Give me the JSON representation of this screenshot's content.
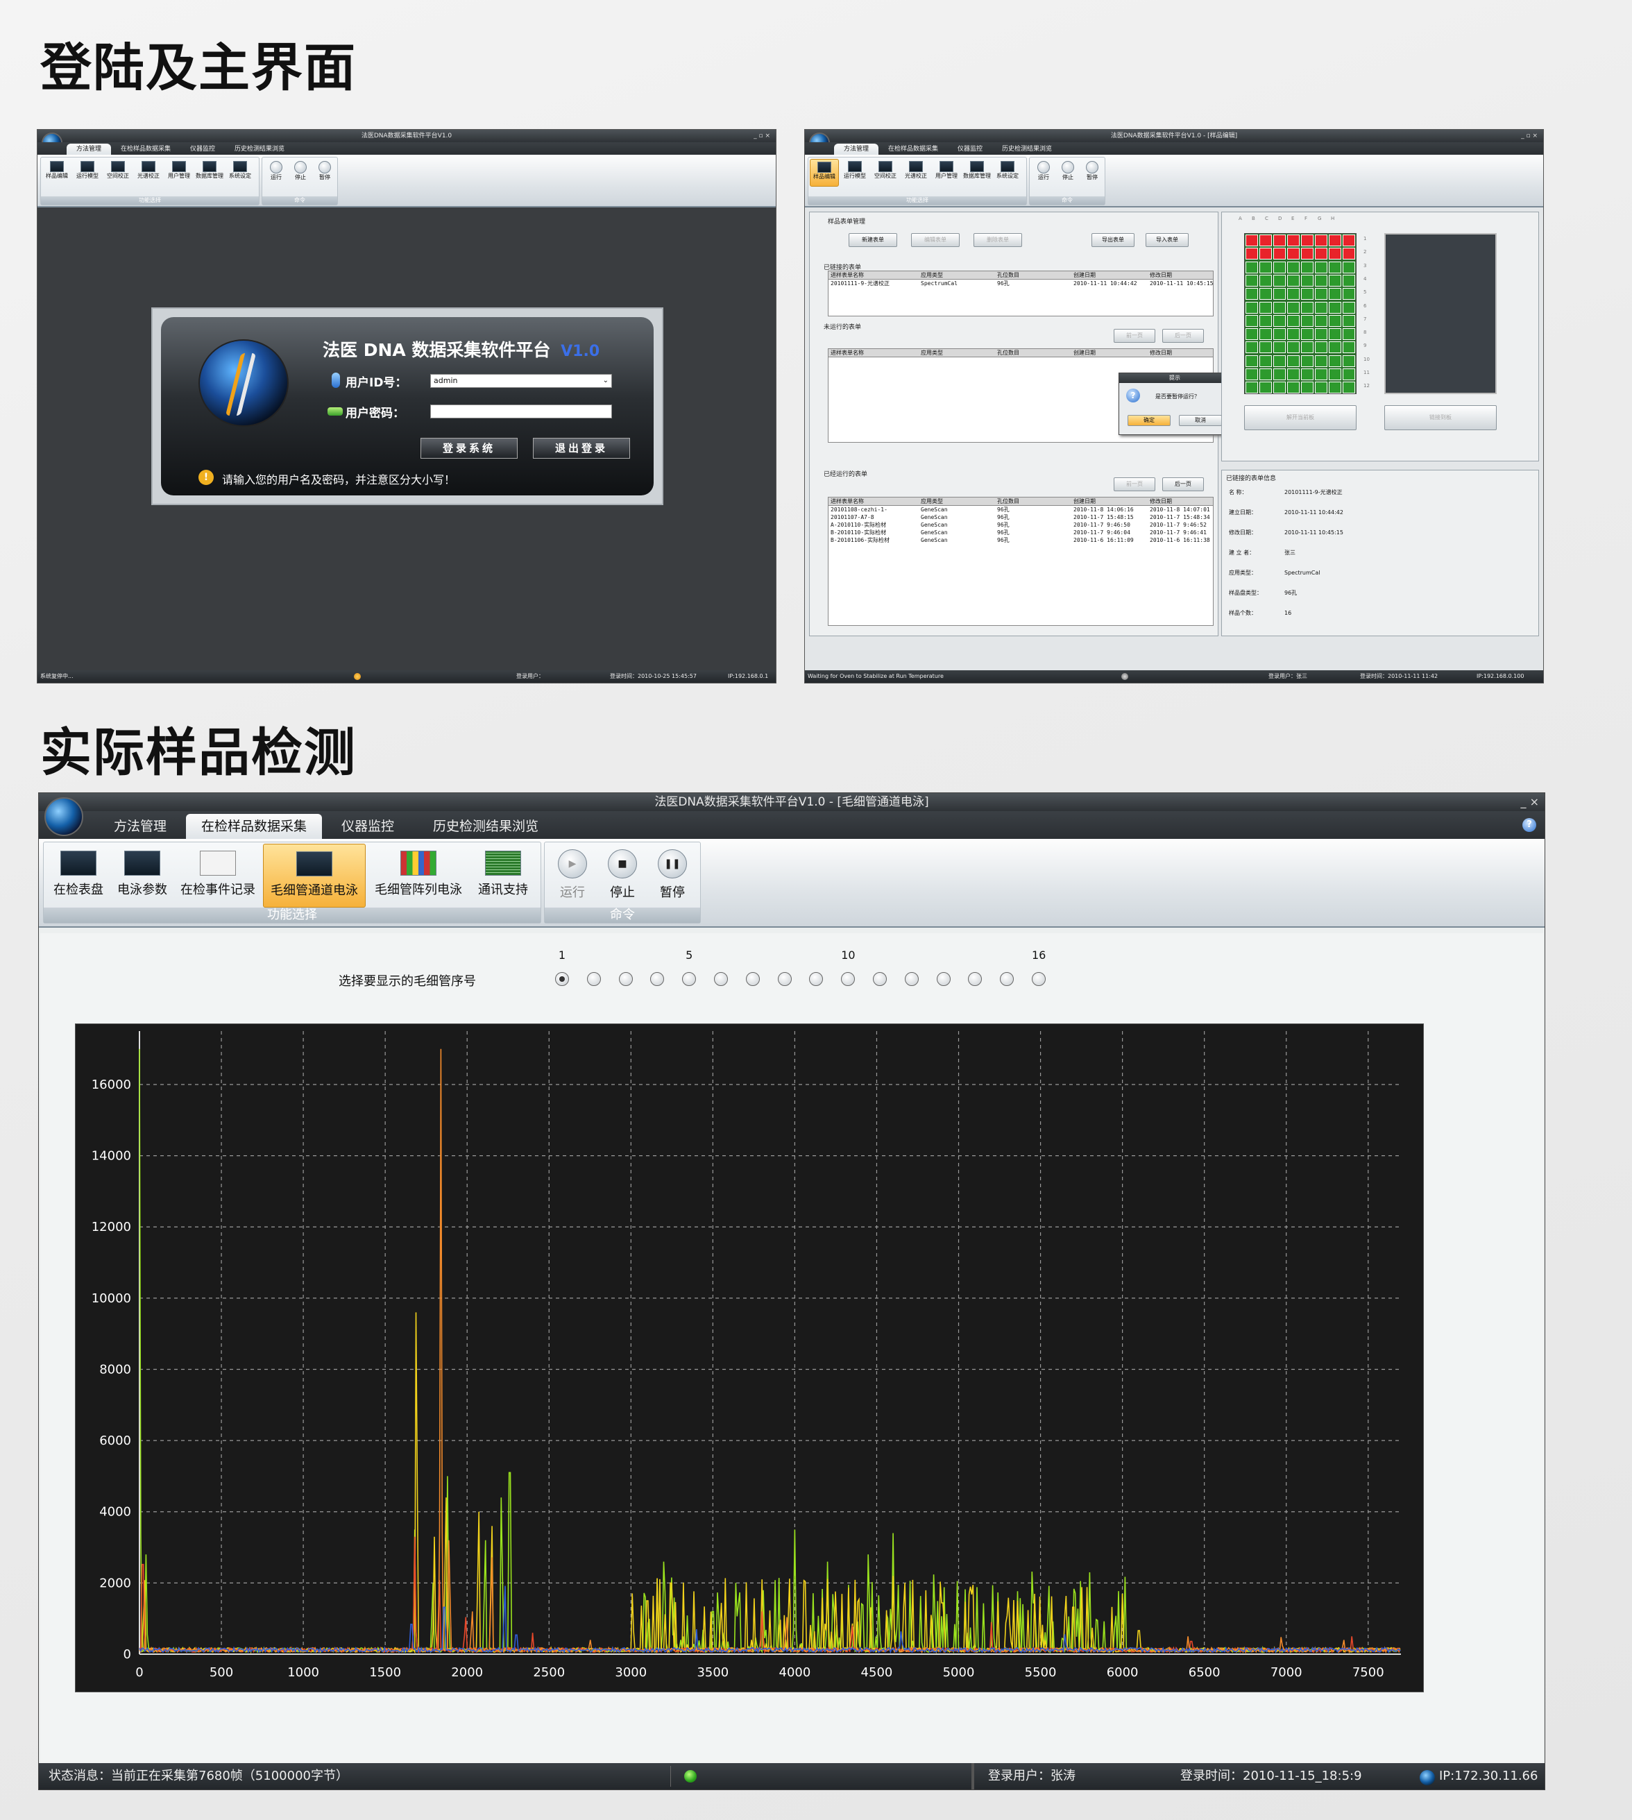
{
  "headings": {
    "login": "登陆及主界面",
    "detection": "实际样品检测"
  },
  "login_window": {
    "title": "法医DNA数据采集软件平台V1.0",
    "tabs": [
      "方法管理",
      "在检样品数据采集",
      "仪器监控",
      "历史检测结果浏览"
    ],
    "ribbon_buttons": [
      "样品编辑",
      "运行模型",
      "空间校正",
      "光谱校正",
      "用户管理",
      "数据库管理",
      "系统设定"
    ],
    "group_caption": "功能选择",
    "cmd_buttons": [
      "运行",
      "停止",
      "暂停"
    ],
    "cmd_caption": "命令",
    "dialog": {
      "title_prefix": "法医 DNA 数据采集软件平台",
      "version": "V1.0",
      "user_id_label": "用户ID号：",
      "user_id_value": "admin",
      "password_label": "用户密码：",
      "login_button": "登录系统",
      "exit_button": "退出登录",
      "hint": "请输入您的用户名及密码，并注意区分大小写！"
    },
    "status": {
      "msg": "系统复停中...",
      "user": "登录用户：",
      "time": "登录时间：2010-10-25 15:45:57",
      "ip": "IP:192.168.0.1"
    }
  },
  "main_window": {
    "title": "法医DNA数据采集软件平台V1.0 - [样品编辑]",
    "tabs": [
      "方法管理",
      "在检样品数据采集",
      "仪器监控",
      "历史检测结果浏览"
    ],
    "ribbon_buttons": [
      "样品编辑",
      "运行模型",
      "空间校正",
      "光谱校正",
      "用户管理",
      "数据库管理",
      "系统设定"
    ],
    "group_caption": "功能选择",
    "cmd_buttons": [
      "运行",
      "停止",
      "暂停"
    ],
    "cmd_caption": "命令",
    "sample_table_panel": "样品表单管理",
    "buttons_top": [
      "新建表单",
      "编辑表单",
      "删除表单",
      "导出表单",
      "导入表单"
    ],
    "linked_label": "已链接的表单",
    "table_headers": [
      "进样表单名称",
      "应用类型",
      "孔位数目",
      "创建日期",
      "修改日期"
    ],
    "linked_rows": [
      [
        "20101111-9-光谱校正",
        "SpectrumCal",
        "96孔",
        "2010-11-11 10:44:42",
        "2010-11-11 10:45:15"
      ]
    ],
    "not_run_label": "未运行的表单",
    "page_buttons": [
      "前一页",
      "后一页"
    ],
    "run_label": "已经运行的表单",
    "run_rows": [
      [
        "20101108-cezhi-1-",
        "GeneScan",
        "96孔",
        "2010-11-8 14:06:16",
        "2010-11-8 14:07:01"
      ],
      [
        "20101107-A7-8",
        "GeneScan",
        "96孔",
        "2010-11-7 15:48:15",
        "2010-11-7 15:48:34"
      ],
      [
        "A-2010110-实际检材",
        "GeneScan",
        "96孔",
        "2010-11-7 9:46:50",
        "2010-11-7 9:46:52"
      ],
      [
        "B-2010110-实际检材",
        "GeneScan",
        "96孔",
        "2010-11-7 9:46:04",
        "2010-11-7 9:46:41"
      ],
      [
        "B-20101106-实际检材",
        "GeneScan",
        "96孔",
        "2010-11-6 16:11:09",
        "2010-11-6 16:11:38"
      ]
    ],
    "dialog": {
      "title": "提示",
      "text": "是否要暂停运行？",
      "ok": "确定",
      "cancel": "取消"
    },
    "plate_columns": [
      "A",
      "B",
      "C",
      "D",
      "E",
      "F",
      "G",
      "H"
    ],
    "plate_buttons": [
      "解开当前板",
      "链接到板"
    ],
    "info_label": "已链接的表单信息",
    "info": [
      [
        "名    称：",
        "20101111-9-光谱校正"
      ],
      [
        "建立日期：",
        "2010-11-11 10:44:42"
      ],
      [
        "修改日期：",
        "2010-11-11 10:45:15"
      ],
      [
        "建 立 者：",
        "张三"
      ],
      [
        "应用类型：",
        "SpectrumCal"
      ],
      [
        "样品盘类型：",
        "96孔"
      ],
      [
        "样品个数：",
        "16"
      ]
    ],
    "status": {
      "msg": "Waiting for Oven to Stabilize at Run Temperature",
      "user": "登录用户：张三",
      "time": "登录时间：2010-11-11 11:42",
      "ip": "IP:192.168.0.100"
    }
  },
  "big_window": {
    "title": "法医DNA数据采集软件平台V1.0 - [毛细管通道电泳]",
    "tabs": [
      "方法管理",
      "在检样品数据采集",
      "仪器监控",
      "历史检测结果浏览"
    ],
    "ribbon_buttons": [
      "在检表盘",
      "电泳参数",
      "在检事件记录",
      "毛细管通道电泳",
      "毛细管阵列电泳",
      "通讯支持"
    ],
    "ribbon_icons": [
      "plate-icon",
      "chart-icon",
      "log-icon",
      "electropherogram-icon",
      "array-icon",
      "comm-icon"
    ],
    "group_caption": "功能选择",
    "cmd_buttons": [
      "运行",
      "停止",
      "暂停"
    ],
    "cmd_caption": "命令",
    "capillary_label": "选择要显示的毛细管序号",
    "capillary_ticks": [
      {
        "n": "1",
        "i": 0
      },
      {
        "n": "5",
        "i": 4
      },
      {
        "n": "10",
        "i": 9
      },
      {
        "n": "16",
        "i": 15
      }
    ],
    "capillary_count": 16,
    "capillary_selected": 1,
    "status": {
      "msg": "状态消息：当前正在采集第7680帧（5100000字节）",
      "user": "登录用户：张涛",
      "time": "登录时间：2010-11-15_18:5:9",
      "ip": "IP:172.30.11.66"
    }
  },
  "chart_data": {
    "type": "line",
    "xlim": [
      0,
      7700
    ],
    "ylim": [
      0,
      17500
    ],
    "x_ticks": [
      0,
      500,
      1000,
      1500,
      2000,
      2500,
      3000,
      3500,
      4000,
      4500,
      5000,
      5500,
      6000,
      6500,
      7000,
      7500
    ],
    "y_ticks": [
      0,
      2000,
      4000,
      6000,
      8000,
      10000,
      12000,
      14000,
      16000
    ],
    "grid": true,
    "background": "#1a1a1a",
    "series": [
      {
        "color": "#9be31e",
        "peaks": [
          [
            0,
            17000
          ],
          [
            40,
            2800
          ],
          [
            1680,
            3500
          ],
          [
            1790,
            2500
          ],
          [
            1880,
            5000
          ],
          [
            2110,
            4000
          ],
          [
            2210,
            5500
          ],
          [
            2260,
            8500
          ],
          [
            3200,
            2600
          ],
          [
            3500,
            2000
          ],
          [
            4000,
            3500
          ],
          [
            4200,
            2600
          ],
          [
            4450,
            3500
          ],
          [
            4600,
            3400
          ],
          [
            4850,
            2800
          ],
          [
            5450,
            2900
          ],
          [
            5550,
            2400
          ],
          [
            5800,
            2300
          ],
          [
            6000,
            1700
          ]
        ]
      },
      {
        "color": "#f2d21b",
        "peaks": [
          [
            30,
            2600
          ],
          [
            1690,
            12000
          ],
          [
            1800,
            3300
          ],
          [
            1870,
            5500
          ],
          [
            2070,
            5000
          ],
          [
            2150,
            4500
          ],
          [
            3100,
            2500
          ],
          [
            3250,
            2500
          ],
          [
            3550,
            1800
          ],
          [
            3800,
            2100
          ],
          [
            4250,
            2200
          ],
          [
            4600,
            2200
          ],
          [
            4900,
            2400
          ],
          [
            5300,
            1800
          ],
          [
            5700,
            2200
          ],
          [
            6100,
            1100
          ]
        ]
      },
      {
        "color": "#e8482a",
        "peaks": [
          [
            20,
            4200
          ],
          [
            1680,
            3300
          ],
          [
            1830,
            2600
          ],
          [
            1990,
            1300
          ],
          [
            2400,
            600
          ],
          [
            3800,
            1200
          ],
          [
            4350,
            1000
          ],
          [
            5200,
            900
          ],
          [
            6420,
            600
          ],
          [
            7400,
            500
          ]
        ]
      },
      {
        "color": "#f28a2b",
        "peaks": [
          [
            1840,
            17000
          ],
          [
            1890,
            4000
          ],
          [
            2030,
            1500
          ],
          [
            2150,
            3400
          ],
          [
            2750,
            500
          ],
          [
            3950,
            1300
          ],
          [
            6400,
            500
          ],
          [
            6970,
            600
          ],
          [
            7350,
            500
          ]
        ]
      },
      {
        "color": "#2f5ed8",
        "peaks": [
          [
            1660,
            1400
          ],
          [
            1860,
            2200
          ],
          [
            2230,
            2400
          ],
          [
            2300,
            900
          ],
          [
            3400,
            700
          ],
          [
            4650,
            800
          ],
          [
            5650,
            700
          ]
        ]
      }
    ]
  }
}
